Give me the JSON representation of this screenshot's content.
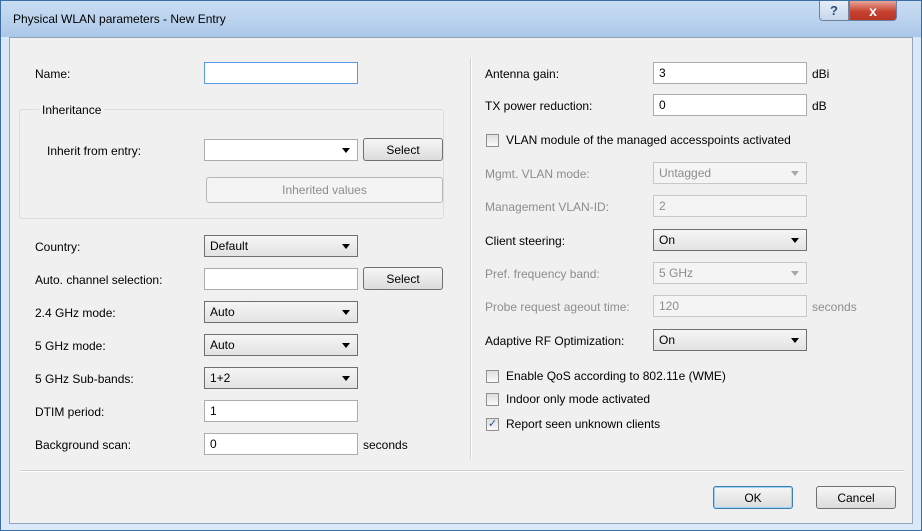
{
  "window": {
    "title": "Physical WLAN parameters - New Entry",
    "help_label": "?",
    "close_label": "x"
  },
  "left": {
    "name_label": "Name:",
    "name_value": "",
    "inheritance_title": "Inheritance",
    "inherit_from_label": "Inherit from entry:",
    "inherit_from_value": "",
    "select_label": "Select",
    "inherited_values_label": "Inherited values",
    "country_label": "Country:",
    "country_value": "Default",
    "auto_channel_label": "Auto. channel selection:",
    "auto_channel_value": "",
    "auto_channel_select_label": "Select",
    "mode24_label": "2.4 GHz mode:",
    "mode24_value": "Auto",
    "mode5_label": "5 GHz mode:",
    "mode5_value": "Auto",
    "subbands_label": "5 GHz Sub-bands:",
    "subbands_value": "1+2",
    "dtim_label": "DTIM period:",
    "dtim_value": "1",
    "bgscan_label": "Background scan:",
    "bgscan_value": "0",
    "bgscan_unit": "seconds"
  },
  "right": {
    "antenna_gain_label": "Antenna gain:",
    "antenna_gain_value": "3",
    "antenna_gain_unit": "dBi",
    "tx_power_label": "TX power reduction:",
    "tx_power_value": "0",
    "tx_power_unit": "dB",
    "vlan_module_label": "VLAN module of the managed accesspoints activated",
    "vlan_module_checked": false,
    "mgmt_vlan_mode_label": "Mgmt. VLAN mode:",
    "mgmt_vlan_mode_value": "Untagged",
    "mgmt_vlan_id_label": "Management VLAN-ID:",
    "mgmt_vlan_id_value": "2",
    "client_steering_label": "Client steering:",
    "client_steering_value": "On",
    "pref_band_label": "Pref. frequency band:",
    "pref_band_value": "5 GHz",
    "probe_ageout_label": "Probe request ageout time:",
    "probe_ageout_value": "120",
    "probe_ageout_unit": "seconds",
    "adaptive_rf_label": "Adaptive RF Optimization:",
    "adaptive_rf_value": "On",
    "qos_label": "Enable QoS according to 802.11e (WME)",
    "qos_checked": false,
    "indoor_label": "Indoor only mode activated",
    "indoor_checked": false,
    "report_label": "Report seen unknown clients",
    "report_checked": true,
    "check_glyph": "✓"
  },
  "footer": {
    "ok_label": "OK",
    "cancel_label": "Cancel"
  },
  "colors": {
    "title_bar": "#bcd4ee",
    "close_button": "#c8412f",
    "dialog_bg": "#f0f0f0",
    "disabled_text": "#8d8d8d"
  }
}
